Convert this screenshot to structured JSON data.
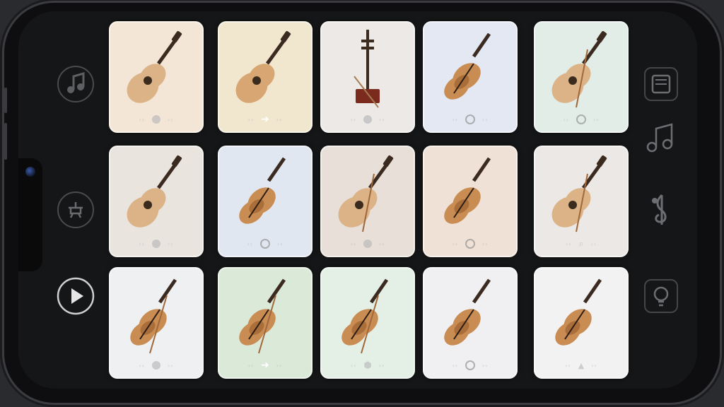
{
  "app": {
    "title": ""
  },
  "left_rail": {
    "items": [
      {
        "name": "music-notes-icon"
      },
      {
        "name": "tuner-icon"
      },
      {
        "name": "play-icon"
      }
    ]
  },
  "right_rail": {
    "items": [
      {
        "name": "library-icon"
      },
      {
        "name": "music-notes-icon"
      },
      {
        "name": "treble-clef-icon"
      },
      {
        "name": "bulb-icon"
      }
    ]
  },
  "grid": {
    "rows": 3,
    "cols": 5,
    "cards": [
      {
        "instrument": "ukulele",
        "bg": "#f3e6d6",
        "control": "dot"
      },
      {
        "instrument": "classical-guitar",
        "bg": "#f1e7cf",
        "control": "arrow"
      },
      {
        "instrument": "erhu",
        "bg": "#ece9e7",
        "control": "dot"
      },
      {
        "instrument": "violin",
        "bg": "#e3e8f2",
        "control": "ring"
      },
      {
        "instrument": "ukulele-with-bow",
        "bg": "#e2ede8",
        "control": "ring"
      },
      {
        "instrument": "ukulele",
        "bg": "#e9e4de",
        "control": "dot"
      },
      {
        "instrument": "violin",
        "bg": "#e0e7f0",
        "control": "ring"
      },
      {
        "instrument": "ukulele-with-bow",
        "bg": "#e7dfd8",
        "control": "dot"
      },
      {
        "instrument": "violin",
        "bg": "#efe1d5",
        "control": "ring"
      },
      {
        "instrument": "ukulele-with-bow",
        "bg": "#ece8e5",
        "control": "search"
      },
      {
        "instrument": "violin-with-bow",
        "bg": "#eef0f2",
        "control": "dot"
      },
      {
        "instrument": "violin-with-bow",
        "bg": "#dbe9d8",
        "control": "arrow"
      },
      {
        "instrument": "violin-with-bow",
        "bg": "#e4efe6",
        "control": "hex"
      },
      {
        "instrument": "violin",
        "bg": "#f0f0f2",
        "control": "ring"
      },
      {
        "instrument": "violin",
        "bg": "#f2f2f2",
        "control": "lock"
      }
    ]
  },
  "colors": {
    "wood": "#c98c52",
    "wood_dark": "#8a4f21",
    "neck": "#3a2a20",
    "erhu_body": "#7a2b1e"
  }
}
